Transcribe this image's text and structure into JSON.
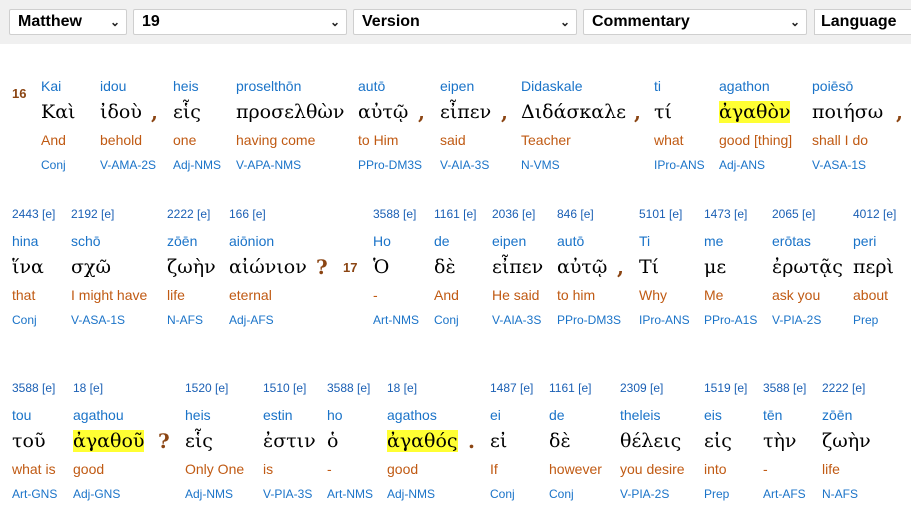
{
  "toolbar": {
    "book": "Matthew",
    "chapter": "19",
    "version": "Version",
    "commentary": "Commentary",
    "language": "Language"
  },
  "verses": [
    "16",
    "17"
  ],
  "rows": [
    [
      {
        "strong": "",
        "translit": "Kai",
        "greek": "Καὶ",
        "gloss": "And",
        "parse": "Conj"
      },
      {
        "strong": "",
        "translit": "idou",
        "greek": "ἰδοὺ",
        "gloss": "behold",
        "parse": "V-AMA-2S",
        "punct": ","
      },
      {
        "strong": "",
        "translit": "heis",
        "greek": "εἷς",
        "gloss": "one",
        "parse": "Adj-NMS"
      },
      {
        "strong": "",
        "translit": "proselthōn",
        "greek": "προσελθὼν",
        "gloss": "having come",
        "parse": "V-APA-NMS"
      },
      {
        "strong": "",
        "translit": "autō",
        "greek": "αὐτῷ",
        "gloss": "to Him",
        "parse": "PPro-DM3S",
        "punct": ","
      },
      {
        "strong": "",
        "translit": "eipen",
        "greek": "εἶπεν",
        "gloss": "said",
        "parse": "V-AIA-3S",
        "punct": ","
      },
      {
        "strong": "",
        "translit": "Didaskale",
        "greek": "Διδάσκαλε",
        "gloss": "Teacher",
        "parse": "N-VMS",
        "punct": ","
      },
      {
        "strong": "",
        "translit": "ti",
        "greek": "τί",
        "gloss": "what",
        "parse": "IPro-ANS"
      },
      {
        "strong": "",
        "translit": "agathon",
        "greek": "ἀγαθὸν",
        "gloss": "good [thing]",
        "parse": "Adj-ANS",
        "hl": true
      },
      {
        "strong": "",
        "translit": "poiēsō",
        "greek": "ποιήσω",
        "gloss": "shall I do",
        "parse": "V-ASA-1S",
        "punct": ","
      }
    ],
    [
      {
        "strong": "2443 [e]",
        "translit": "hina",
        "greek": "ἵνα",
        "gloss": "that",
        "parse": "Conj"
      },
      {
        "strong": "2192 [e]",
        "translit": "schō",
        "greek": "σχῶ",
        "gloss": "I might have",
        "parse": "V-ASA-1S"
      },
      {
        "strong": "2222 [e]",
        "translit": "zōēn",
        "greek": "ζωὴν",
        "gloss": "life",
        "parse": "N-AFS"
      },
      {
        "strong": "166 [e]",
        "translit": "aiōnion",
        "greek": "αἰώνιον",
        "gloss": "eternal",
        "parse": "Adj-AFS",
        "punct": "?"
      },
      {
        "strong": "3588 [e]",
        "translit": "Ho",
        "greek": "Ὁ",
        "gloss": "-",
        "parse": "Art-NMS"
      },
      {
        "strong": "1161 [e]",
        "translit": "de",
        "greek": "δὲ",
        "gloss": "And",
        "parse": "Conj"
      },
      {
        "strong": "2036 [e]",
        "translit": "eipen",
        "greek": "εἶπεν",
        "gloss": "He said",
        "parse": "V-AIA-3S"
      },
      {
        "strong": "846 [e]",
        "translit": "autō",
        "greek": "αὐτῷ",
        "gloss": "to him",
        "parse": "PPro-DM3S",
        "punct": ","
      },
      {
        "strong": "5101 [e]",
        "translit": "Ti",
        "greek": "Τί",
        "gloss": "Why",
        "parse": "IPro-ANS"
      },
      {
        "strong": "1473 [e]",
        "translit": "me",
        "greek": "με",
        "gloss": "Me",
        "parse": "PPro-A1S"
      },
      {
        "strong": "2065 [e]",
        "translit": "erōtas",
        "greek": "ἐρωτᾷς",
        "gloss": "ask you",
        "parse": "V-PIA-2S"
      },
      {
        "strong": "4012 [e]",
        "translit": "peri",
        "greek": "περὶ",
        "gloss": "about",
        "parse": "Prep"
      }
    ],
    [
      {
        "strong": "3588 [e]",
        "translit": "tou",
        "greek": "τοῦ",
        "gloss": "what is",
        "parse": "Art-GNS"
      },
      {
        "strong": "18 [e]",
        "translit": "agathou",
        "greek": "ἀγαθοῦ",
        "gloss": "good",
        "parse": "Adj-GNS",
        "punct": "?",
        "hl": true
      },
      {
        "strong": "1520 [e]",
        "translit": "heis",
        "greek": "εἷς",
        "gloss": "Only One",
        "parse": "Adj-NMS"
      },
      {
        "strong": "1510 [e]",
        "translit": "estin",
        "greek": "ἐστιν",
        "gloss": "is",
        "parse": "V-PIA-3S"
      },
      {
        "strong": "3588 [e]",
        "translit": "ho",
        "greek": "ὁ",
        "gloss": "-",
        "parse": "Art-NMS"
      },
      {
        "strong": "18 [e]",
        "translit": "agathos",
        "greek": "ἀγαθός",
        "gloss": "good",
        "parse": "Adj-NMS",
        "punct": ".",
        "hl": true
      },
      {
        "strong": "1487 [e]",
        "translit": "ei",
        "greek": "εἰ",
        "gloss": "If",
        "parse": "Conj"
      },
      {
        "strong": "1161 [e]",
        "translit": "de",
        "greek": "δὲ",
        "gloss": "however",
        "parse": "Conj"
      },
      {
        "strong": "2309 [e]",
        "translit": "theleis",
        "greek": "θέλεις",
        "gloss": "you desire",
        "parse": "V-PIA-2S"
      },
      {
        "strong": "1519 [e]",
        "translit": "eis",
        "greek": "εἰς",
        "gloss": "into",
        "parse": "Prep"
      },
      {
        "strong": "3588 [e]",
        "translit": "tēn",
        "greek": "τὴν",
        "gloss": "-",
        "parse": "Art-AFS"
      },
      {
        "strong": "2222 [e]",
        "translit": "zōēn",
        "greek": "ζωὴν",
        "gloss": "life",
        "parse": "N-AFS"
      }
    ]
  ],
  "colors": {
    "toolbar_bg": "#f0f0f0",
    "translit": "#1a73c8",
    "gloss": "#c05a13",
    "punct": "#8b4513",
    "highlight": "#ffff33"
  }
}
